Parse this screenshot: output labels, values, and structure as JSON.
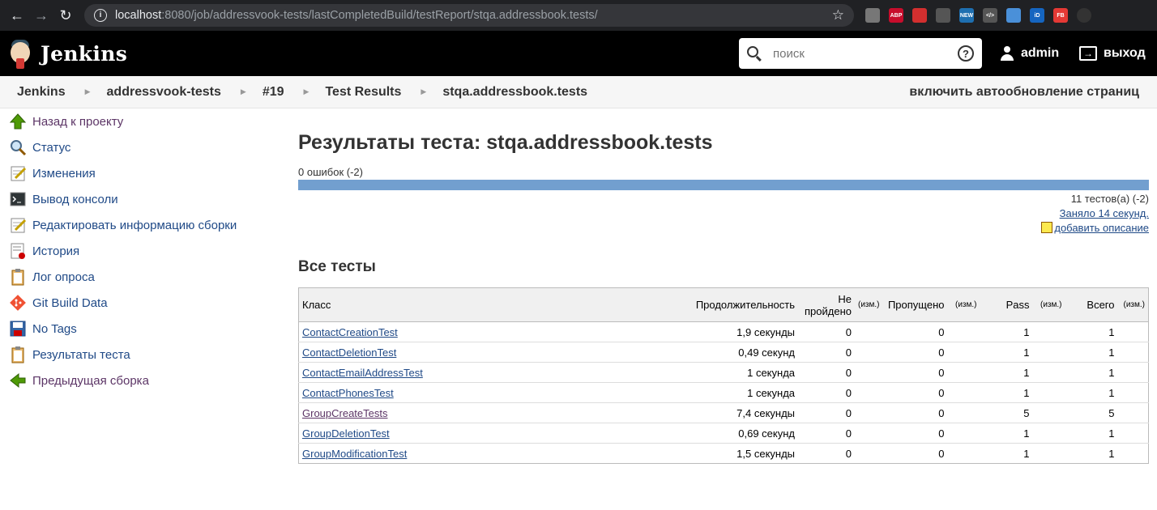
{
  "browser": {
    "url_host": "localhost",
    "url_rest": ":8080/job/addressvook-tests/lastCompletedBuild/testReport/stqa.addressbook.tests/",
    "extensions": [
      {
        "name": "ext-hand",
        "label": "",
        "color": "#777"
      },
      {
        "name": "ext-abp",
        "label": "ABP",
        "color": "#c70d2c"
      },
      {
        "name": "ext-red",
        "label": "",
        "color": "#d32f2f"
      },
      {
        "name": "ext-gear",
        "label": "",
        "color": "#555"
      },
      {
        "name": "ext-new",
        "label": "NEW",
        "color": "#1e6fb0"
      },
      {
        "name": "ext-code",
        "label": "</>",
        "color": "#555"
      },
      {
        "name": "ext-cloud",
        "label": "",
        "color": "#4a90d9"
      },
      {
        "name": "ext-id",
        "label": "iD",
        "color": "#1565c0"
      },
      {
        "name": "ext-fb",
        "label": "FB",
        "color": "#e53935"
      },
      {
        "name": "ext-dot",
        "label": "",
        "color": "#333"
      }
    ]
  },
  "header": {
    "title": "Jenkins",
    "search_placeholder": "поиск",
    "help": "?",
    "user": "admin",
    "logout": "выход"
  },
  "breadcrumbs": [
    "Jenkins",
    "addressvook-tests",
    "#19",
    "Test Results",
    "stqa.addressbook.tests"
  ],
  "autorefresh": "включить автообновление страниц",
  "sidebar": [
    {
      "label": "Назад к проекту",
      "icon": "up-arrow-icon",
      "visited": true
    },
    {
      "label": "Статус",
      "icon": "magnifier-icon",
      "visited": false
    },
    {
      "label": "Изменения",
      "icon": "notepad-icon",
      "visited": false
    },
    {
      "label": "Вывод консоли",
      "icon": "terminal-icon",
      "visited": false
    },
    {
      "label": "Редактировать информацию сборки",
      "icon": "notepad-icon",
      "visited": false
    },
    {
      "label": "История",
      "icon": "history-icon",
      "visited": false
    },
    {
      "label": "Лог опроса",
      "icon": "clipboard-icon",
      "visited": false
    },
    {
      "label": "Git Build Data",
      "icon": "git-icon",
      "visited": false
    },
    {
      "label": "No Tags",
      "icon": "save-icon",
      "visited": false
    },
    {
      "label": "Результаты теста",
      "icon": "clipboard-icon",
      "visited": false
    },
    {
      "label": "Предыдущая сборка",
      "icon": "left-arrow-icon",
      "visited": true
    }
  ],
  "main": {
    "title": "Результаты теста: stqa.addressbook.tests",
    "failures": "0 ошибок (-2)",
    "pass_fraction": 1.0,
    "tests_count": "11 тестов(а) (-2)",
    "duration": "Заняло 14 секунд.",
    "add_description": "добавить описание",
    "all_tests": "Все тесты"
  },
  "table": {
    "headers": {
      "class": "Класс",
      "duration": "Продолжительность",
      "failed": "Не пройдено",
      "diff": "(изм.)",
      "skipped": "Пропущено",
      "pass": "Pass",
      "total": "Всего"
    },
    "rows": [
      {
        "class": "ContactCreationTest",
        "duration": "1,9 секунды",
        "failed": "0",
        "skipped": "0",
        "pass": "1",
        "total": "1",
        "visited": false
      },
      {
        "class": "ContactDeletionTest",
        "duration": "0,49 секунд",
        "failed": "0",
        "skipped": "0",
        "pass": "1",
        "total": "1",
        "visited": false
      },
      {
        "class": "ContactEmailAddressTest",
        "duration": "1 секунда",
        "failed": "0",
        "skipped": "0",
        "pass": "1",
        "total": "1",
        "visited": false
      },
      {
        "class": "ContactPhonesTest",
        "duration": "1 секунда",
        "failed": "0",
        "skipped": "0",
        "pass": "1",
        "total": "1",
        "visited": false
      },
      {
        "class": "GroupCreateTests",
        "duration": "7,4 секунды",
        "failed": "0",
        "skipped": "0",
        "pass": "5",
        "total": "5",
        "visited": true
      },
      {
        "class": "GroupDeletionTest",
        "duration": "0,69 секунд",
        "failed": "0",
        "skipped": "0",
        "pass": "1",
        "total": "1",
        "visited": false
      },
      {
        "class": "GroupModificationTest",
        "duration": "1,5 секунды",
        "failed": "0",
        "skipped": "0",
        "pass": "1",
        "total": "1",
        "visited": false
      }
    ]
  }
}
